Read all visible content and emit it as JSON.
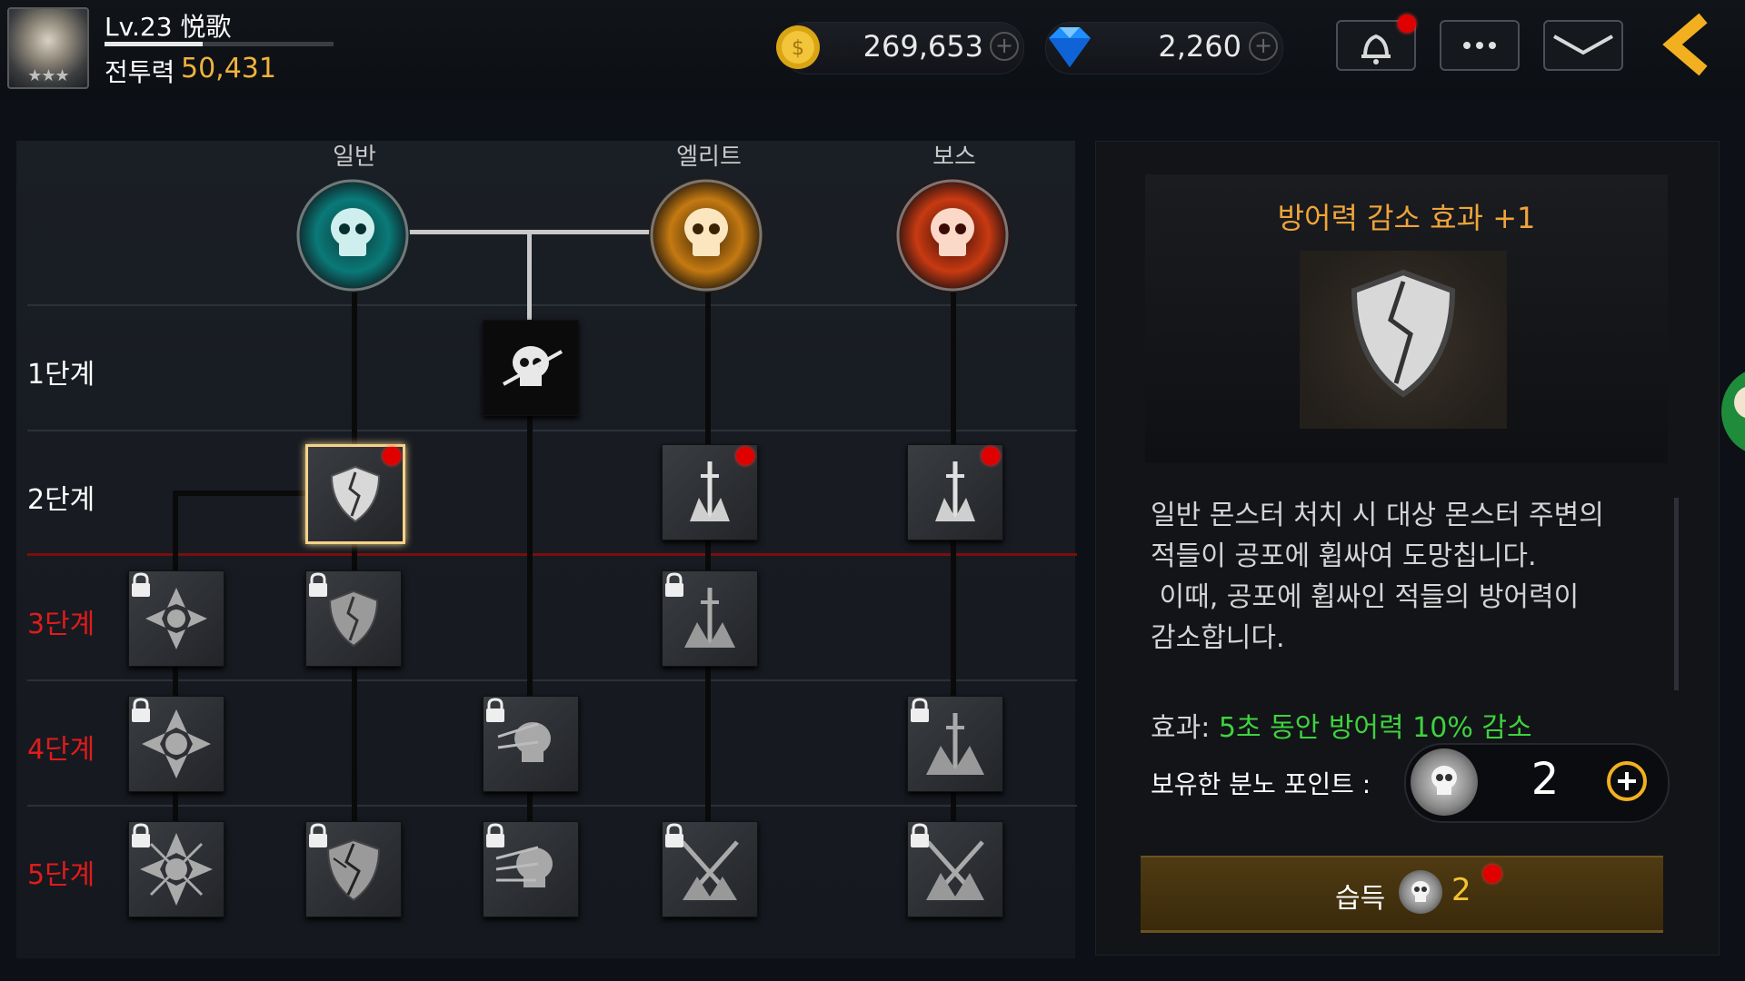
{
  "header": {
    "level_text": "Lv.23 悦歌",
    "exp_progress": 0.43,
    "combat_power_label": "전투력",
    "combat_power_value": "50,431",
    "gold": "269,653",
    "gems": "2,260"
  },
  "skill_tree": {
    "columns": [
      "일반",
      "엘리트",
      "보스"
    ],
    "tiers": [
      "1단계",
      "2단계",
      "3단계",
      "4단계",
      "5단계"
    ],
    "unlocked_tiers": 2
  },
  "detail": {
    "title": "방어력 감소 효과 +1",
    "description": [
      "일반 몬스터 처치 시 대상 몬스터 주변의",
      "적들이 공포에 휩싸여 도망칩니다.",
      " 이때, 공포에 휩싸인 적들의 방어력이",
      "감소합니다."
    ],
    "effect_label": "효과:",
    "effect_value": "5초 동안 방어력 10% 감소",
    "rage_points_label": "보유한 분노 포인트 :",
    "rage_points_value": "2",
    "learn_button_label": "습득",
    "learn_cost": "2"
  },
  "colors": {
    "accent_orange": "#f0a43a",
    "effect_green": "#3fd23f",
    "locked_tier_red": "#e11b1b",
    "gold_text": "#f0b23c"
  }
}
